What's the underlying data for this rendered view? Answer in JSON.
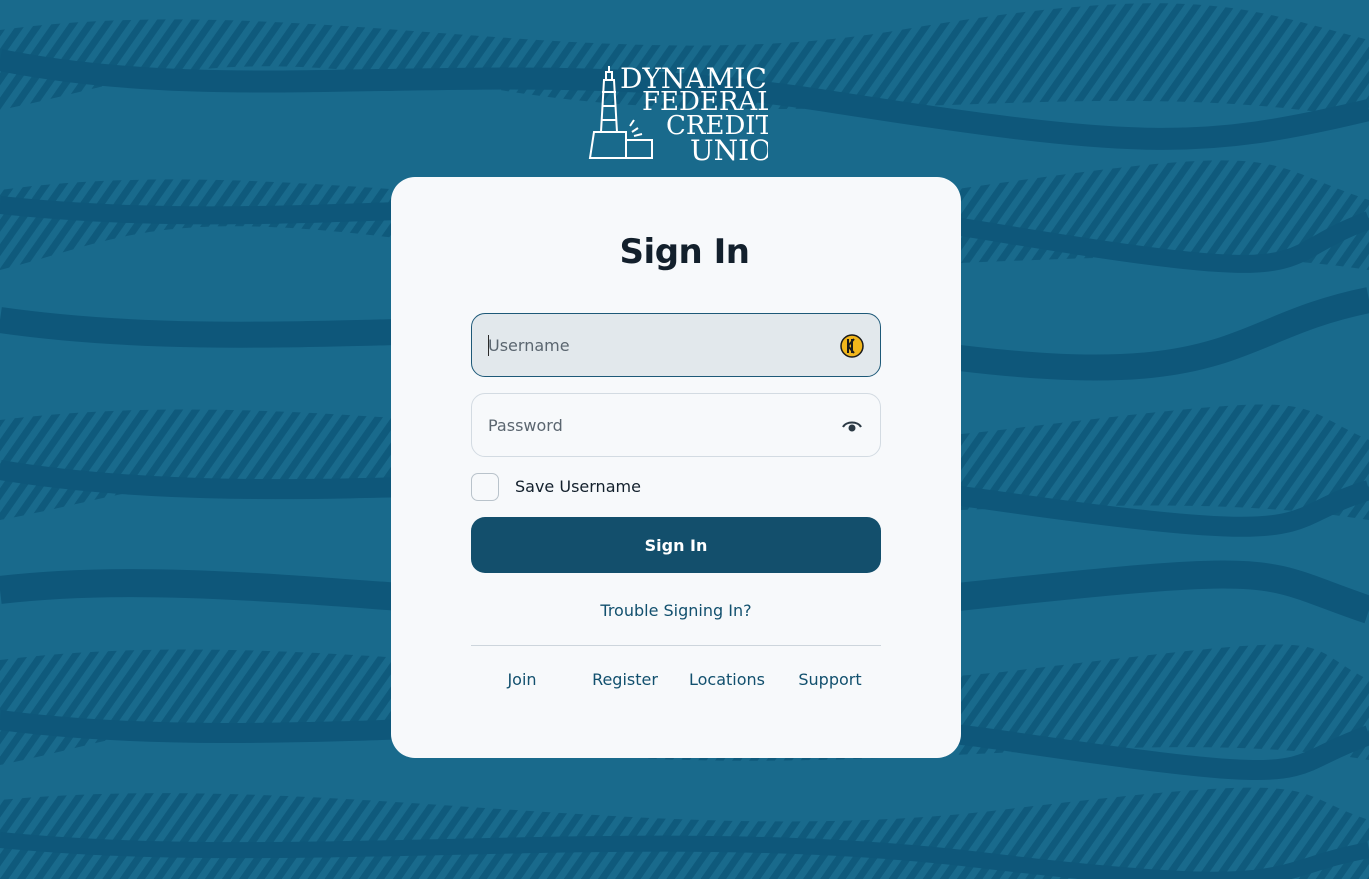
{
  "brand": {
    "logo_lines": [
      "DYNAMIC",
      "FEDERAL",
      "CREDIT",
      "UNION"
    ],
    "background_color": "#196a8c",
    "primary_button_color": "#134f6c",
    "link_color": "#12506e"
  },
  "signin": {
    "title": "Sign In",
    "username": {
      "placeholder": "Username",
      "value": "",
      "icon": "password-manager-icon"
    },
    "password": {
      "placeholder": "Password",
      "value": "",
      "icon": "eye-icon"
    },
    "save_username": {
      "label": "Save Username",
      "checked": false
    },
    "submit_label": "Sign In",
    "trouble_link": "Trouble Signing In?"
  },
  "footer_links": [
    {
      "label": "Join"
    },
    {
      "label": "Register"
    },
    {
      "label": "Locations"
    },
    {
      "label": "Support"
    }
  ]
}
